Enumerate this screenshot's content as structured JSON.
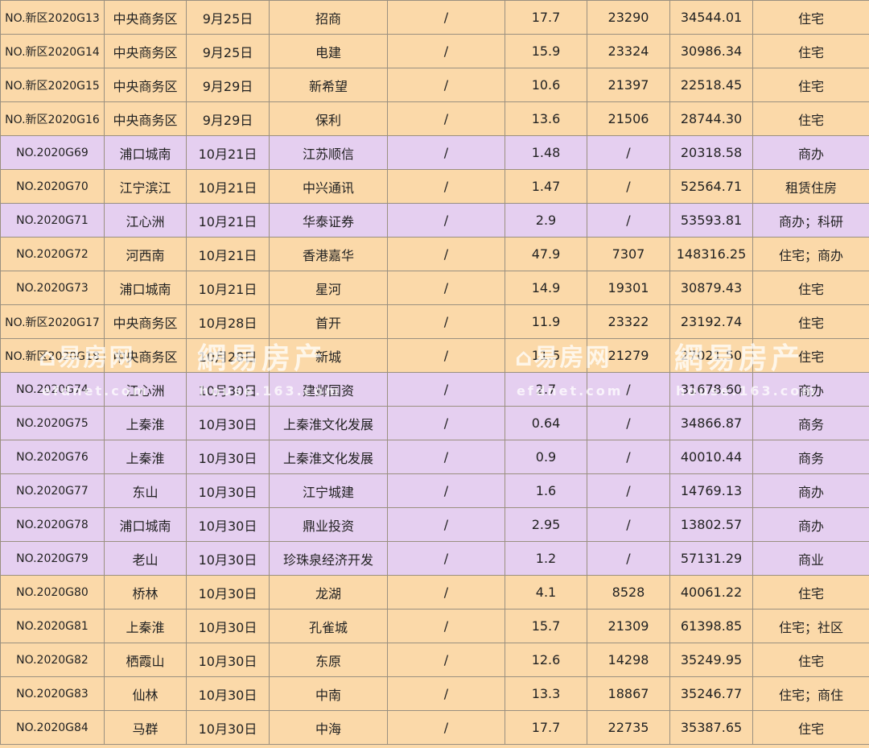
{
  "rows": [
    {
      "no": "NO.新区2020G13",
      "area": "中央商务区",
      "date": "9月25日",
      "buyer": "招商",
      "c4": "/",
      "c5": "17.7",
      "c6": "23290",
      "c7": "34544.01",
      "use": "住宅",
      "color": "orange"
    },
    {
      "no": "NO.新区2020G14",
      "area": "中央商务区",
      "date": "9月25日",
      "buyer": "电建",
      "c4": "/",
      "c5": "15.9",
      "c6": "23324",
      "c7": "30986.34",
      "use": "住宅",
      "color": "orange"
    },
    {
      "no": "NO.新区2020G15",
      "area": "中央商务区",
      "date": "9月29日",
      "buyer": "新希望",
      "c4": "/",
      "c5": "10.6",
      "c6": "21397",
      "c7": "22518.45",
      "use": "住宅",
      "color": "orange"
    },
    {
      "no": "NO.新区2020G16",
      "area": "中央商务区",
      "date": "9月29日",
      "buyer": "保利",
      "c4": "/",
      "c5": "13.6",
      "c6": "21506",
      "c7": "28744.30",
      "use": "住宅",
      "color": "orange"
    },
    {
      "no": "NO.2020G69",
      "area": "浦口城南",
      "date": "10月21日",
      "buyer": "江苏顺信",
      "c4": "/",
      "c5": "1.48",
      "c6": "/",
      "c7": "20318.58",
      "use": "商办",
      "color": "purple"
    },
    {
      "no": "NO.2020G70",
      "area": "江宁滨江",
      "date": "10月21日",
      "buyer": "中兴通讯",
      "c4": "/",
      "c5": "1.47",
      "c6": "/",
      "c7": "52564.71",
      "use": "租赁住房",
      "color": "orange"
    },
    {
      "no": "NO.2020G71",
      "area": "江心洲",
      "date": "10月21日",
      "buyer": "华泰证券",
      "c4": "/",
      "c5": "2.9",
      "c6": "/",
      "c7": "53593.81",
      "use": "商办；科研",
      "color": "purple"
    },
    {
      "no": "NO.2020G72",
      "area": "河西南",
      "date": "10月21日",
      "buyer": "香港嘉华",
      "c4": "/",
      "c5": "47.9",
      "c6": "7307",
      "c7": "148316.25",
      "use": "住宅；商办",
      "color": "orange"
    },
    {
      "no": "NO.2020G73",
      "area": "浦口城南",
      "date": "10月21日",
      "buyer": "星河",
      "c4": "/",
      "c5": "14.9",
      "c6": "19301",
      "c7": "30879.43",
      "use": "住宅",
      "color": "orange"
    },
    {
      "no": "NO.新区2020G17",
      "area": "中央商务区",
      "date": "10月28日",
      "buyer": "首开",
      "c4": "/",
      "c5": "11.9",
      "c6": "23322",
      "c7": "23192.74",
      "use": "住宅",
      "color": "orange"
    },
    {
      "no": "NO.新区2020G18",
      "area": "中央商务区",
      "date": "10月28日",
      "buyer": "新城",
      "c4": "/",
      "c5": "11.5",
      "c6": "21279",
      "c7": "27021.50",
      "use": "住宅",
      "color": "orange"
    },
    {
      "no": "NO.2020G74",
      "area": "江心洲",
      "date": "10月30日",
      "buyer": "建邺国资",
      "c4": "/",
      "c5": "2.7",
      "c6": "/",
      "c7": "31678.60",
      "use": "商办",
      "color": "purple"
    },
    {
      "no": "NO.2020G75",
      "area": "上秦淮",
      "date": "10月30日",
      "buyer": "上秦淮文化发展",
      "c4": "/",
      "c5": "0.64",
      "c6": "/",
      "c7": "34866.87",
      "use": "商务",
      "color": "purple"
    },
    {
      "no": "NO.2020G76",
      "area": "上秦淮",
      "date": "10月30日",
      "buyer": "上秦淮文化发展",
      "c4": "/",
      "c5": "0.9",
      "c6": "/",
      "c7": "40010.44",
      "use": "商务",
      "color": "purple"
    },
    {
      "no": "NO.2020G77",
      "area": "东山",
      "date": "10月30日",
      "buyer": "江宁城建",
      "c4": "/",
      "c5": "1.6",
      "c6": "/",
      "c7": "14769.13",
      "use": "商办",
      "color": "purple"
    },
    {
      "no": "NO.2020G78",
      "area": "浦口城南",
      "date": "10月30日",
      "buyer": "鼎业投资",
      "c4": "/",
      "c5": "2.95",
      "c6": "/",
      "c7": "13802.57",
      "use": "商办",
      "color": "purple"
    },
    {
      "no": "NO.2020G79",
      "area": "老山",
      "date": "10月30日",
      "buyer": "珍珠泉经济开发",
      "c4": "/",
      "c5": "1.2",
      "c6": "/",
      "c7": "57131.29",
      "use": "商业",
      "color": "purple"
    },
    {
      "no": "NO.2020G80",
      "area": "桥林",
      "date": "10月30日",
      "buyer": "龙湖",
      "c4": "/",
      "c5": "4.1",
      "c6": "8528",
      "c7": "40061.22",
      "use": "住宅",
      "color": "orange"
    },
    {
      "no": "NO.2020G81",
      "area": "上秦淮",
      "date": "10月30日",
      "buyer": "孔雀城",
      "c4": "/",
      "c5": "15.7",
      "c6": "21309",
      "c7": "61398.85",
      "use": "住宅；社区",
      "color": "orange"
    },
    {
      "no": "NO.2020G82",
      "area": "栖霞山",
      "date": "10月30日",
      "buyer": "东原",
      "c4": "/",
      "c5": "12.6",
      "c6": "14298",
      "c7": "35249.95",
      "use": "住宅",
      "color": "orange"
    },
    {
      "no": "NO.2020G83",
      "area": "仙林",
      "date": "10月30日",
      "buyer": "中南",
      "c4": "/",
      "c5": "13.3",
      "c6": "18867",
      "c7": "35246.77",
      "use": "住宅；商住",
      "color": "orange"
    },
    {
      "no": "NO.2020G84",
      "area": "马群",
      "date": "10月30日",
      "buyer": "中海",
      "c4": "/",
      "c5": "17.7",
      "c6": "22735",
      "c7": "35387.65",
      "use": "住宅",
      "color": "orange"
    }
  ],
  "watermarks": {
    "efu_brand": "易房网",
    "efu_url": "efdnet.com",
    "netease_brand": "網易房产",
    "netease_url": "house.163.com"
  }
}
